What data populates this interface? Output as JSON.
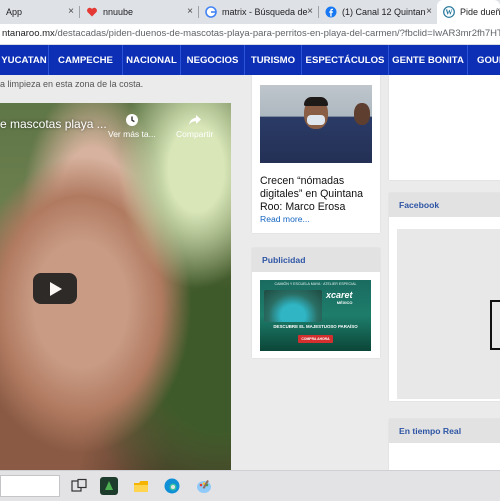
{
  "browser": {
    "tabs": [
      {
        "title": "App",
        "icon": "whatsapp-icon",
        "active": false
      },
      {
        "title": "nnuube",
        "icon": "heart-icon",
        "active": false
      },
      {
        "title": "matrix - Búsqueda de",
        "icon": "google-icon",
        "active": false
      },
      {
        "title": "(1) Canal 12 Quintana",
        "icon": "facebook-icon",
        "active": false
      },
      {
        "title": "Pide dueñ",
        "icon": "wordpress-icon",
        "active": true
      }
    ],
    "close_glyph": "×",
    "address": {
      "domain": "ntanaroo.mx",
      "path": "/destacadas/piden-duenos-de-mascotas-playa-para-perritos-en-playa-del-carmen/?fbclid=IwAR3mr2fh7HT..."
    }
  },
  "nav": {
    "items": [
      "YUCATAN",
      "CAMPECHE",
      "NACIONAL",
      "NEGOCIOS",
      "TURISMO",
      "ESPECTÁCULOS",
      "GENTE BONITA",
      "GOUR"
    ]
  },
  "article": {
    "snippet": "a limpieza en esta zona de la costa."
  },
  "video": {
    "title": "e mascotas playa ...",
    "watch_later": "Ver más ta...",
    "share": "Compartir"
  },
  "news_card": {
    "headline": "Crecen “nómadas digitales” en Quintana Roo: Marco Erosa",
    "read_more": "Read more..."
  },
  "ad_card": {
    "header": "Publicidad",
    "ad": {
      "top_text": "CAMIÓN Y ESCUELA MAYA · ATELIER ESPECIAL",
      "logo": "xcaret",
      "logo_sub": "MÉXICO",
      "tagline": "DESCUBRE EL MAJESTUOSO PARAÍSO",
      "cta": "COMPRA AHORA"
    }
  },
  "sidebar": {
    "facebook_header": "Facebook",
    "realtime_header": "En tiempo Real"
  },
  "colors": {
    "nav_bg": "#0c2fb5",
    "link": "#1565c0",
    "card_header_text": "#2e55a5"
  }
}
